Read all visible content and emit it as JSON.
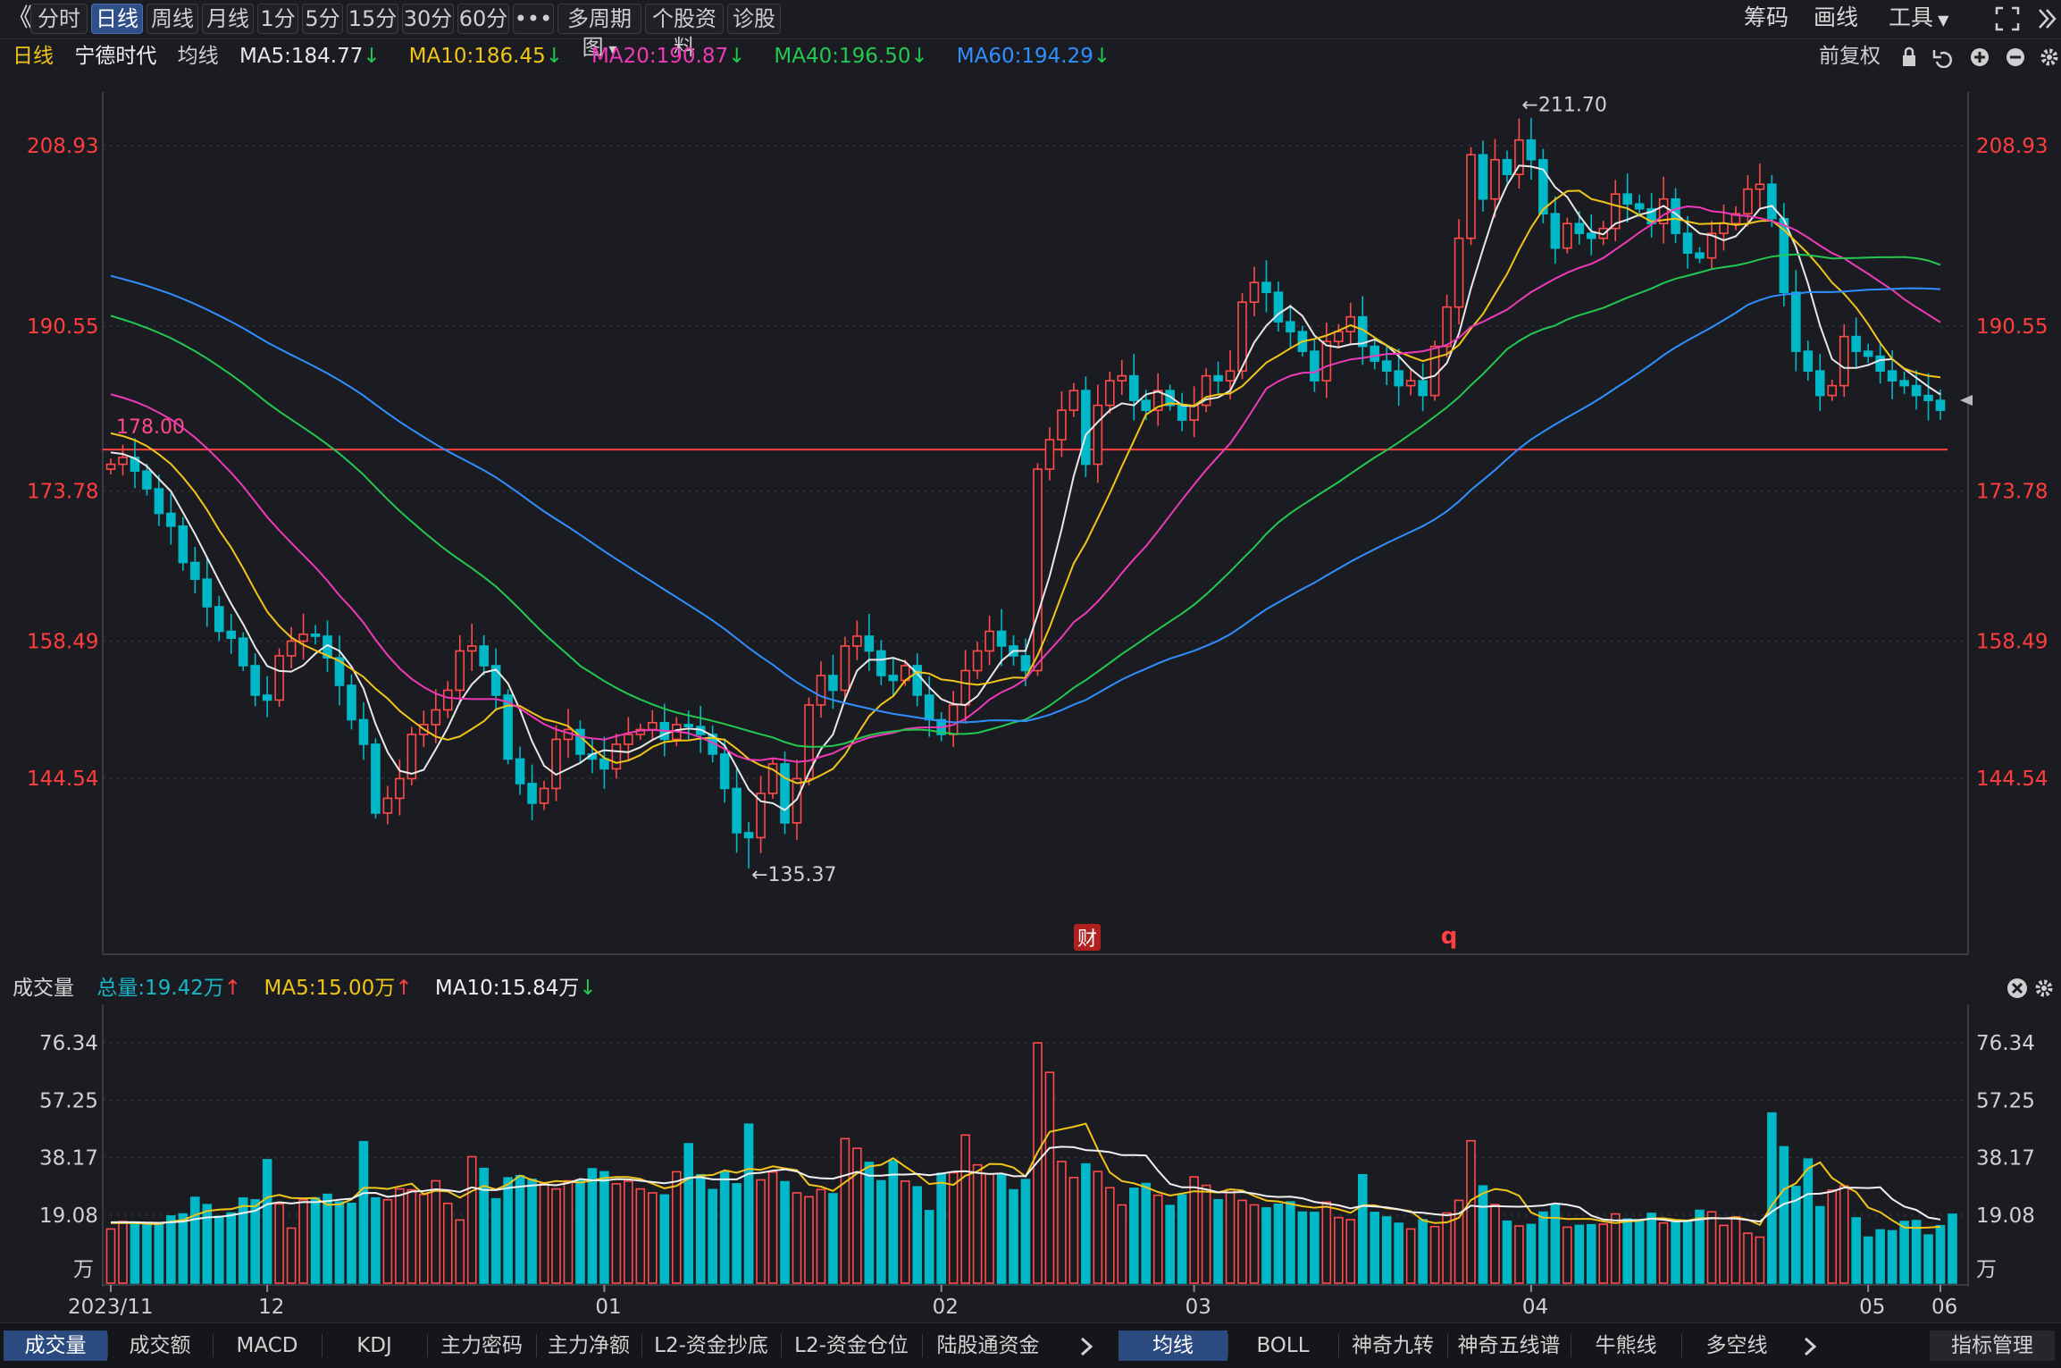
{
  "toolbar": {
    "back_label": "《",
    "period_tabs": [
      "分时",
      "日线",
      "周线",
      "月线",
      "1分",
      "5分",
      "15分",
      "30分",
      "60分",
      "•••",
      "多周期图",
      "个股资料",
      "诊股"
    ],
    "active_tab": "日线",
    "right_items": [
      "筹码",
      "画线",
      "工具"
    ]
  },
  "ma_header": {
    "period": "日线",
    "stock_name": "宁德时代",
    "avg_label": "均线",
    "ma": [
      {
        "label": "MA5:184.77",
        "color": "#e8e8e8",
        "arrow": "↓"
      },
      {
        "label": "MA10:186.45",
        "color": "#f0c419",
        "arrow": "↓"
      },
      {
        "label": "MA20:190.87",
        "color": "#ee3ab8",
        "arrow": "↓"
      },
      {
        "label": "MA40:196.50",
        "color": "#22c84f",
        "arrow": "↓"
      },
      {
        "label": "MA60:194.29",
        "color": "#2f8fff",
        "arrow": "↓"
      }
    ],
    "adjust_label": "前复权"
  },
  "price_axis": {
    "ticks": [
      208.93,
      190.55,
      173.78,
      158.49,
      144.54
    ],
    "min": 130,
    "max": 215
  },
  "annotations": {
    "high": "←211.70",
    "low": "←135.37",
    "hline": "178.00",
    "finance_badge": "财",
    "q_badge": "q"
  },
  "volume_header": {
    "label": "成交量",
    "total": "总量:19.42万",
    "ma5": "MA5:15.00万",
    "ma10": "MA10:15.84万"
  },
  "volume_axis": {
    "ticks": [
      "76.34",
      "57.25",
      "38.17",
      "19.08",
      "万"
    ]
  },
  "x_axis": {
    "labels": [
      "2023/11",
      "12",
      "01",
      "02",
      "03",
      "04",
      "05",
      "06"
    ]
  },
  "indicator_tabs": [
    "成交量",
    "成交额",
    "MACD",
    "KDJ",
    "主力密码",
    "主力净额",
    "L2-资金抄底",
    "L2-资金仓位",
    "陆股通资金"
  ],
  "overlay_tabs": [
    "均线",
    "BOLL",
    "神奇九转",
    "神奇五线谱",
    "牛熊线",
    "多空线"
  ],
  "indicator_manage": "指标管理",
  "colors": {
    "up": "#ff4a4a",
    "down": "#00b8c8",
    "bg": "#1b1c21",
    "grid": "#30313a",
    "axis_red": "#ff3d3d"
  },
  "chart_data": {
    "type": "candlestick",
    "title": "宁德时代 日线",
    "ylim": [
      130,
      215
    ],
    "x_labels": [
      "2023/11",
      "12",
      "01",
      "02",
      "03",
      "04",
      "05",
      "06"
    ],
    "reference_line": 178.0,
    "series": [
      {
        "name": "MA5",
        "color": "#e8e8e8",
        "last": 184.77
      },
      {
        "name": "MA10",
        "color": "#f0c419",
        "last": 186.45
      },
      {
        "name": "MA20",
        "color": "#ee3ab8",
        "last": 190.87
      },
      {
        "name": "MA40",
        "color": "#22c84f",
        "last": 196.5
      },
      {
        "name": "MA60",
        "color": "#2f8fff",
        "last": 194.29
      }
    ],
    "closes": [
      176.5,
      177.2,
      175.8,
      174.0,
      171.5,
      170.2,
      166.5,
      164.8,
      162.0,
      159.5,
      158.8,
      156.0,
      153.0,
      152.5,
      157.0,
      158.5,
      159.2,
      159.0,
      156.8,
      154.0,
      150.5,
      148.0,
      141.0,
      142.5,
      144.5,
      149.0,
      150.0,
      151.5,
      153.5,
      157.5,
      158.0,
      156.0,
      153.0,
      146.5,
      144.0,
      142.0,
      143.5,
      148.5,
      149.5,
      147.0,
      146.5,
      145.5,
      148.0,
      149.0,
      149.5,
      150.2,
      148.5,
      150.0,
      149.8,
      149.0,
      147.0,
      143.5,
      139.0,
      138.5,
      143.0,
      146.0,
      140.0,
      144.5,
      152.0,
      155.0,
      153.5,
      158.0,
      159.0,
      157.5,
      155.0,
      154.5,
      156.0,
      153.0,
      150.5,
      149.0,
      152.0,
      155.5,
      157.5,
      159.5,
      158.0,
      157.0,
      155.5,
      176.0,
      179.0,
      182.0,
      184.0,
      176.5,
      182.5,
      185.0,
      185.5,
      183.0,
      182.0,
      184.0,
      182.5,
      181.0,
      182.5,
      185.5,
      185.0,
      186.0,
      193.0,
      195.0,
      194.0,
      191.0,
      190.0,
      188.0,
      185.0,
      189.0,
      190.0,
      191.5,
      188.5,
      187.0,
      186.0,
      184.5,
      185.0,
      183.5,
      188.5,
      192.5,
      199.5,
      208.0,
      203.5,
      207.5,
      206.0,
      209.5,
      207.5,
      202.0,
      198.5,
      201.0,
      200.0,
      199.5,
      200.5,
      204.0,
      203.0,
      202.5,
      201.0,
      203.5,
      200.0,
      198.0,
      197.5,
      200.0,
      201.0,
      202.0,
      204.5,
      205.0,
      201.5,
      194.0,
      188.0,
      186.0,
      183.5,
      184.5,
      189.5,
      188.0,
      187.5,
      186.0,
      185.0,
      184.5,
      183.5,
      183.0,
      182.0
    ],
    "volumes": [
      14.5,
      17.0,
      16.8,
      15.8,
      16.4,
      18.8,
      19.5,
      25.0,
      22.6,
      18.7,
      19.8,
      24.8,
      24.2,
      37.5,
      22.8,
      14.8,
      24.2,
      24.8,
      26.0,
      23.5,
      23.0,
      43.5,
      24.8,
      24.2,
      27.8,
      27.5,
      26.0,
      30.5,
      23.0,
      17.5,
      38.5,
      34.6,
      24.5,
      31.5,
      32.2,
      31.0,
      29.5,
      27.8,
      30.5,
      30.8,
      34.5,
      33.5,
      29.5,
      30.4,
      27.8,
      26.5,
      25.8,
      33.5,
      42.8,
      32.5,
      27.6,
      33.5,
      29.5,
      49.3,
      30.8,
      33.4,
      30.2,
      26.5,
      25.2,
      27.6,
      26.2,
      44.5,
      41.3,
      36.6,
      30.5,
      37.1,
      30.4,
      28.5,
      20.6,
      33.0,
      33.2,
      45.7,
      35.8,
      32.8,
      32.6,
      27.5,
      30.9,
      76.3,
      66.5,
      36.9,
      31.6,
      36.1,
      33.6,
      28.2,
      22.5,
      28.0,
      29.6,
      25.7,
      22.3,
      25.8,
      31.8,
      29.0,
      24.2,
      27.6,
      24.0,
      22.5,
      21.5,
      22.7,
      23.5,
      20.1,
      20.0,
      23.4,
      18.3,
      17.6,
      32.5,
      20.0,
      18.5,
      16.4,
      14.5,
      17.6,
      15.3,
      19.8,
      24.0,
      43.8,
      28.8,
      22.6,
      17.1,
      15.5,
      16.0,
      20.1,
      22.4,
      15.1,
      15.7,
      15.9,
      16.1,
      19.5,
      17.8,
      16.9,
      19.7,
      16.5,
      16.7,
      16.7,
      20.7,
      20.2,
      15.7,
      18.5,
      13.1,
      11.8,
      53.0,
      41.8,
      28.6,
      37.7,
      21.9,
      27.4,
      28.8,
      18.2,
      11.8,
      14.2,
      13.9,
      17.0,
      17.3,
      12.5,
      15.6,
      19.4
    ]
  }
}
